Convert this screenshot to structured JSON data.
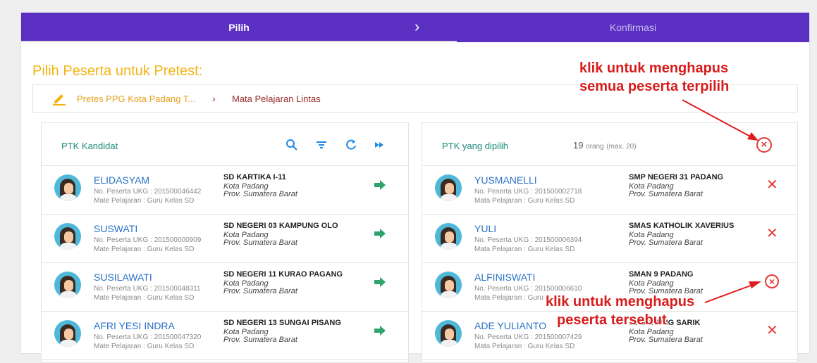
{
  "stepper": {
    "step1": "Pilih",
    "step2": "Konfirmasi",
    "chevron": "›"
  },
  "page_title": "Pilih Peserta untuk Pretest:",
  "breadcrumb": {
    "item1": "Pretes PPG Kota Padang T...",
    "separator": "›",
    "item2": "Mata Pelajaran Lintas"
  },
  "left_panel": {
    "title": "PTK Kandidat",
    "icons": [
      "search-icon",
      "filter-icon",
      "refresh-icon",
      "fast-forward-icon"
    ],
    "rows": [
      {
        "name": "ELIDASYAM",
        "no": "No. Peserta UKG : 201500046442",
        "mapel": "Mate Pelajaran : Guru Kelas SD",
        "school": "SD KARTIKA I-11",
        "kota": "Kota Padang",
        "prov": "Prov. Sumatera Barat"
      },
      {
        "name": "SUSWATI",
        "no": "No. Peserta UKG : 201500000909",
        "mapel": "Mate Pelajaran : Guru Kelas SD",
        "school": "SD NEGERI 03 KAMPUNG OLO",
        "kota": "Kota Padang",
        "prov": "Prov. Sumatera Barat"
      },
      {
        "name": "SUSILAWATI",
        "no": "No. Peserta UKG : 201500048311",
        "mapel": "Mate Pelajaran : Guru Kelas SD",
        "school": "SD NEGERI 11 KURAO PAGANG",
        "kota": "Kota Padang",
        "prov": "Prov. Sumatera Barat"
      },
      {
        "name": "AFRI YESI INDRA",
        "no": "No. Peserta UKG : 201500047320",
        "mapel": "Mate Pelajaran : Guru Kelas SD",
        "school": "SD NEGERI 13 SUNGAI PISANG",
        "kota": "Kota Padang",
        "prov": "Prov. Sumatera Barat"
      }
    ]
  },
  "right_panel": {
    "title": "PTK yang dipilih",
    "count": "19",
    "count_unit": "orang",
    "count_max": "(max. 20)",
    "rows": [
      {
        "name": "YUSMANELLI",
        "no": "No. Peserta UKG : 201500002718",
        "mapel": "Mata Pelajaran : Guru Kelas SD",
        "school": "SMP NEGERI 31 PADANG",
        "kota": "Kota Padang",
        "prov": "Prov. Sumatera Barat"
      },
      {
        "name": "YULI",
        "no": "No. Peserta UKG : 201500006394",
        "mapel": "Mata Pelajaran : Guru Kelas SD",
        "school": "SMAS KATHOLIK XAVERIUS",
        "kota": "Kota Padang",
        "prov": "Prov. Sumatera Barat"
      },
      {
        "name": "ALFINISWATI",
        "no": "No. Peserta UKG : 201500006610",
        "mapel": "Mata Pelajaran : Guru",
        "school": "SMAN 9 PADANG",
        "kota": "Kota Padang",
        "prov": "Prov. Sumatera Barat"
      },
      {
        "name": "ADE YULIANTO",
        "no": "No. Peserta UKG : 201500007429",
        "mapel": "Mata Pelajaran : Guru Kelas SD",
        "school": "36 GUNUNG SARIK",
        "kota": "Kota Padang",
        "prov": "Prov. Sumatera Barat"
      }
    ]
  },
  "annotations": {
    "top_line1": "klik untuk menghapus",
    "top_line2": "semua peserta terpilih",
    "bottom_line1": "klik untuk menghapus",
    "bottom_line2": "peserta tersebut"
  },
  "colors": {
    "header": "#5a2fc2",
    "title": "#f2b415",
    "teal": "#1b8c7b",
    "name": "#2a72c4",
    "red": "#e53935",
    "green": "#2fa36b"
  }
}
